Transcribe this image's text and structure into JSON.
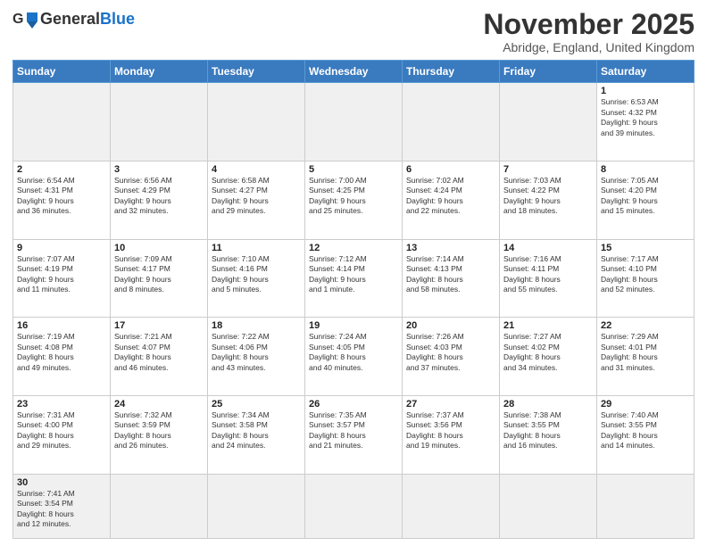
{
  "header": {
    "logo_general": "General",
    "logo_blue": "Blue",
    "month_title": "November 2025",
    "location": "Abridge, England, United Kingdom"
  },
  "weekdays": [
    "Sunday",
    "Monday",
    "Tuesday",
    "Wednesday",
    "Thursday",
    "Friday",
    "Saturday"
  ],
  "weeks": [
    [
      {
        "day": "",
        "info": "",
        "empty": true
      },
      {
        "day": "",
        "info": "",
        "empty": true
      },
      {
        "day": "",
        "info": "",
        "empty": true
      },
      {
        "day": "",
        "info": "",
        "empty": true
      },
      {
        "day": "",
        "info": "",
        "empty": true
      },
      {
        "day": "",
        "info": "",
        "empty": true
      },
      {
        "day": "1",
        "info": "Sunrise: 6:53 AM\nSunset: 4:32 PM\nDaylight: 9 hours\nand 39 minutes."
      }
    ],
    [
      {
        "day": "2",
        "info": "Sunrise: 6:54 AM\nSunset: 4:31 PM\nDaylight: 9 hours\nand 36 minutes."
      },
      {
        "day": "3",
        "info": "Sunrise: 6:56 AM\nSunset: 4:29 PM\nDaylight: 9 hours\nand 32 minutes."
      },
      {
        "day": "4",
        "info": "Sunrise: 6:58 AM\nSunset: 4:27 PM\nDaylight: 9 hours\nand 29 minutes."
      },
      {
        "day": "5",
        "info": "Sunrise: 7:00 AM\nSunset: 4:25 PM\nDaylight: 9 hours\nand 25 minutes."
      },
      {
        "day": "6",
        "info": "Sunrise: 7:02 AM\nSunset: 4:24 PM\nDaylight: 9 hours\nand 22 minutes."
      },
      {
        "day": "7",
        "info": "Sunrise: 7:03 AM\nSunset: 4:22 PM\nDaylight: 9 hours\nand 18 minutes."
      },
      {
        "day": "8",
        "info": "Sunrise: 7:05 AM\nSunset: 4:20 PM\nDaylight: 9 hours\nand 15 minutes."
      }
    ],
    [
      {
        "day": "9",
        "info": "Sunrise: 7:07 AM\nSunset: 4:19 PM\nDaylight: 9 hours\nand 11 minutes."
      },
      {
        "day": "10",
        "info": "Sunrise: 7:09 AM\nSunset: 4:17 PM\nDaylight: 9 hours\nand 8 minutes."
      },
      {
        "day": "11",
        "info": "Sunrise: 7:10 AM\nSunset: 4:16 PM\nDaylight: 9 hours\nand 5 minutes."
      },
      {
        "day": "12",
        "info": "Sunrise: 7:12 AM\nSunset: 4:14 PM\nDaylight: 9 hours\nand 1 minute."
      },
      {
        "day": "13",
        "info": "Sunrise: 7:14 AM\nSunset: 4:13 PM\nDaylight: 8 hours\nand 58 minutes."
      },
      {
        "day": "14",
        "info": "Sunrise: 7:16 AM\nSunset: 4:11 PM\nDaylight: 8 hours\nand 55 minutes."
      },
      {
        "day": "15",
        "info": "Sunrise: 7:17 AM\nSunset: 4:10 PM\nDaylight: 8 hours\nand 52 minutes."
      }
    ],
    [
      {
        "day": "16",
        "info": "Sunrise: 7:19 AM\nSunset: 4:08 PM\nDaylight: 8 hours\nand 49 minutes."
      },
      {
        "day": "17",
        "info": "Sunrise: 7:21 AM\nSunset: 4:07 PM\nDaylight: 8 hours\nand 46 minutes."
      },
      {
        "day": "18",
        "info": "Sunrise: 7:22 AM\nSunset: 4:06 PM\nDaylight: 8 hours\nand 43 minutes."
      },
      {
        "day": "19",
        "info": "Sunrise: 7:24 AM\nSunset: 4:05 PM\nDaylight: 8 hours\nand 40 minutes."
      },
      {
        "day": "20",
        "info": "Sunrise: 7:26 AM\nSunset: 4:03 PM\nDaylight: 8 hours\nand 37 minutes."
      },
      {
        "day": "21",
        "info": "Sunrise: 7:27 AM\nSunset: 4:02 PM\nDaylight: 8 hours\nand 34 minutes."
      },
      {
        "day": "22",
        "info": "Sunrise: 7:29 AM\nSunset: 4:01 PM\nDaylight: 8 hours\nand 31 minutes."
      }
    ],
    [
      {
        "day": "23",
        "info": "Sunrise: 7:31 AM\nSunset: 4:00 PM\nDaylight: 8 hours\nand 29 minutes."
      },
      {
        "day": "24",
        "info": "Sunrise: 7:32 AM\nSunset: 3:59 PM\nDaylight: 8 hours\nand 26 minutes."
      },
      {
        "day": "25",
        "info": "Sunrise: 7:34 AM\nSunset: 3:58 PM\nDaylight: 8 hours\nand 24 minutes."
      },
      {
        "day": "26",
        "info": "Sunrise: 7:35 AM\nSunset: 3:57 PM\nDaylight: 8 hours\nand 21 minutes."
      },
      {
        "day": "27",
        "info": "Sunrise: 7:37 AM\nSunset: 3:56 PM\nDaylight: 8 hours\nand 19 minutes."
      },
      {
        "day": "28",
        "info": "Sunrise: 7:38 AM\nSunset: 3:55 PM\nDaylight: 8 hours\nand 16 minutes."
      },
      {
        "day": "29",
        "info": "Sunrise: 7:40 AM\nSunset: 3:55 PM\nDaylight: 8 hours\nand 14 minutes."
      }
    ],
    [
      {
        "day": "30",
        "info": "Sunrise: 7:41 AM\nSunset: 3:54 PM\nDaylight: 8 hours\nand 12 minutes.",
        "last": true
      },
      {
        "day": "",
        "info": "",
        "empty": true,
        "last": true
      },
      {
        "day": "",
        "info": "",
        "empty": true,
        "last": true
      },
      {
        "day": "",
        "info": "",
        "empty": true,
        "last": true
      },
      {
        "day": "",
        "info": "",
        "empty": true,
        "last": true
      },
      {
        "day": "",
        "info": "",
        "empty": true,
        "last": true
      },
      {
        "day": "",
        "info": "",
        "empty": true,
        "last": true
      }
    ]
  ]
}
